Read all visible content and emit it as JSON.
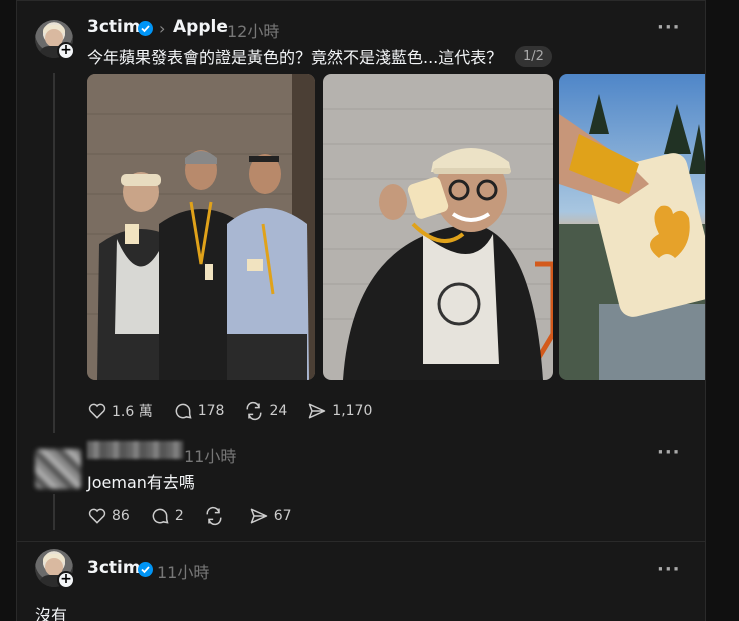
{
  "post": {
    "author": "3ctim",
    "separator": ">",
    "community": "Apple",
    "time": "12小時",
    "text": "今年蘋果發表會的證是黃色的？竟然不是淺藍色...這代表？",
    "page_indicator": "1/2",
    "likes": "1.6 萬",
    "comments": "178",
    "reposts": "24",
    "shares": "1,170"
  },
  "reply1": {
    "time": "11小時",
    "text": "Joeman有去嗎",
    "likes": "86",
    "comments": "2",
    "shares": "67"
  },
  "reply2": {
    "author": "3ctim",
    "time": "11小時",
    "text": "沒有"
  },
  "icons": [
    "verified-icon",
    "chevron-right-icon",
    "more-icon",
    "heart-icon",
    "comment-icon",
    "repost-icon",
    "share-icon",
    "follow-plus-icon"
  ],
  "colors": {
    "background": "#181818",
    "verified": "#0095f6",
    "text": "#f3f5f7",
    "muted": "#777777"
  }
}
